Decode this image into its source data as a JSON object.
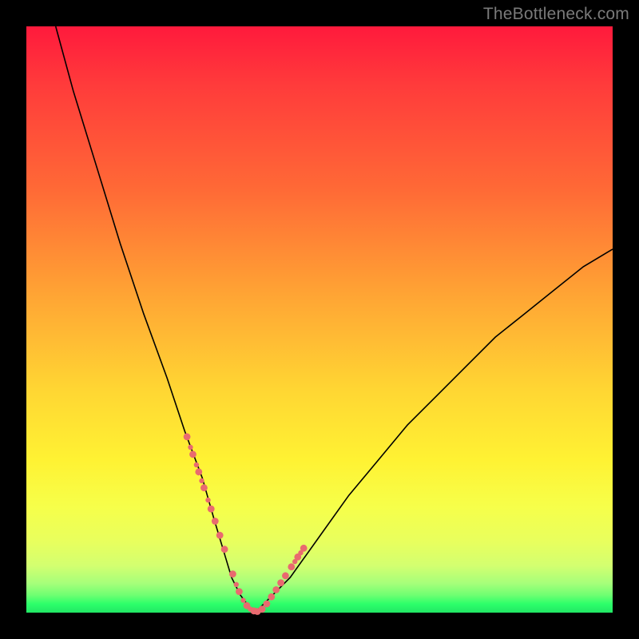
{
  "watermark": "TheBottleneck.com",
  "chart_data": {
    "type": "line",
    "title": "",
    "xlabel": "",
    "ylabel": "",
    "xlim": [
      0,
      100
    ],
    "ylim": [
      0,
      100
    ],
    "grid": false,
    "series": [
      {
        "name": "bottleneck-curve",
        "x": [
          5,
          8,
          12,
          16,
          20,
          24,
          27,
          30,
          32,
          33.5,
          35,
          36.5,
          38,
          39,
          40,
          45,
          50,
          55,
          60,
          65,
          70,
          75,
          80,
          85,
          90,
          95,
          100
        ],
        "y": [
          100,
          89,
          76,
          63,
          51,
          40,
          31,
          23,
          16,
          11,
          6,
          3,
          1,
          0,
          1,
          6,
          13,
          20,
          26,
          32,
          37,
          42,
          47,
          51,
          55,
          59,
          62
        ]
      }
    ],
    "markers": {
      "name": "highlighted-points",
      "x": [
        27.4,
        28.0,
        28.4,
        29.0,
        29.4,
        29.9,
        30.3,
        31.0,
        31.5,
        32.2,
        33.0,
        33.8,
        35.2,
        35.8,
        36.3,
        37.0,
        37.6,
        38.2,
        38.8,
        39.4,
        40.2,
        41.0,
        41.8,
        42.6,
        43.4,
        44.2,
        45.2,
        45.8,
        46.3,
        46.8,
        47.3
      ],
      "y": [
        30.0,
        28.2,
        27.0,
        25.2,
        24.0,
        22.5,
        21.3,
        19.2,
        17.7,
        15.6,
        13.2,
        10.8,
        6.6,
        4.8,
        3.6,
        2.1,
        1.2,
        0.6,
        0.3,
        0.2,
        0.6,
        1.5,
        2.7,
        3.9,
        5.1,
        6.3,
        7.8,
        8.7,
        9.5,
        10.2,
        11.0
      ],
      "r": [
        4.4,
        3.2,
        4.4,
        3.2,
        4.4,
        3.2,
        4.4,
        3.2,
        4.4,
        4.4,
        4.4,
        4.4,
        4.4,
        3.2,
        4.4,
        3.2,
        4.4,
        3.2,
        4.4,
        4.4,
        4.4,
        4.4,
        4.4,
        4.4,
        4.4,
        4.4,
        4.4,
        3.2,
        4.4,
        3.2,
        4.4
      ]
    },
    "colors": {
      "gradient_top": "#ff1a3c",
      "gradient_mid": "#ffd633",
      "gradient_bottom": "#22e765",
      "curve": "#000000",
      "marker": "#e96a6f",
      "background": "#000000"
    }
  }
}
